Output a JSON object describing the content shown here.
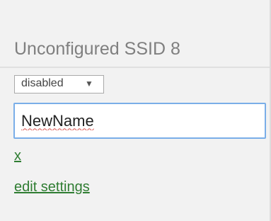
{
  "ssid": {
    "title": "Unconfigured SSID 8",
    "status": {
      "selected": "disabled",
      "caret": "▼"
    },
    "name_input": {
      "value": "NewName"
    },
    "remove_link": "x",
    "edit_link": "edit settings"
  },
  "colors": {
    "panel_bg": "#f2f2f2",
    "title_text": "#7f7f7f",
    "link": "#2f7d32",
    "input_focus_border": "#7aaee8"
  }
}
